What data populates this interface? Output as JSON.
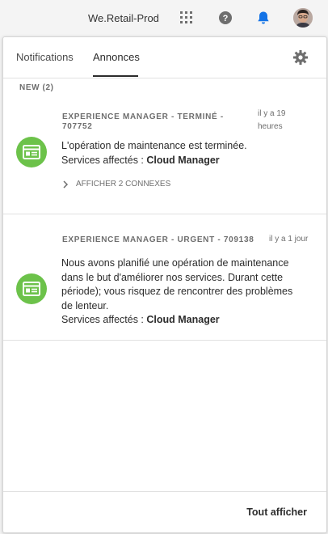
{
  "topbar": {
    "org_name": "We.Retail-Prod",
    "icons": [
      "apps-grid-icon",
      "help-icon",
      "bell-icon",
      "avatar"
    ]
  },
  "panel": {
    "tabs": [
      {
        "label": "Notifications",
        "active": false
      },
      {
        "label": "Annonces",
        "active": true
      }
    ],
    "settings_icon": "gear-icon",
    "section_title": "NEW (2)",
    "announcements": [
      {
        "heading": "EXPERIENCE MANAGER - TERMINÉ - 707752",
        "time": "il y a 19 heures",
        "message": "L'opération de maintenance est terminée.",
        "services_label": "Services affectés : ",
        "services_value": "Cloud Manager",
        "related": "AFFICHER 2 CONNEXES"
      },
      {
        "heading": "EXPERIENCE MANAGER - URGENT - 709138",
        "time": "il y a 1 jour",
        "message": "Nous avons planifié une opération de maintenance dans le but d'améliorer nos services. Durant cette période); vous risquez de rencontrer des problèmes de lenteur.",
        "services_label": "Services affectés : ",
        "services_value": "Cloud Manager"
      }
    ],
    "footer_button": "Tout afficher"
  },
  "colors": {
    "accent_green": "#6cc24a",
    "bell_blue": "#1473e6",
    "text": "#2c2c2c",
    "muted": "#6e6e6e"
  }
}
